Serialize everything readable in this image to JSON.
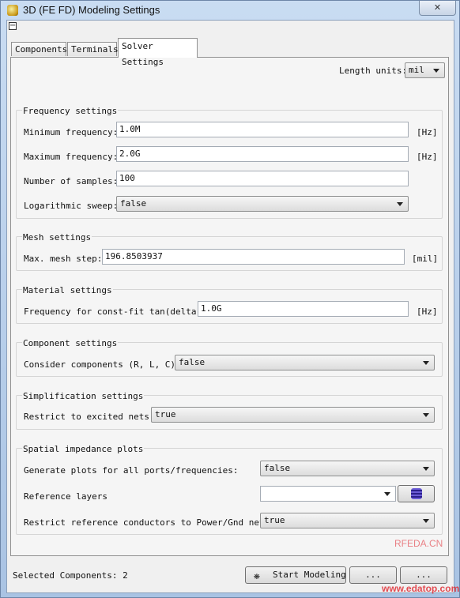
{
  "window": {
    "title": "3D (FE FD) Modeling Settings",
    "close_glyph": "✕"
  },
  "collapse_glyph": "−",
  "tabs": [
    {
      "label": "Components",
      "active": false
    },
    {
      "label": "Terminals",
      "active": false
    },
    {
      "label": "Solver Settings",
      "active": true
    }
  ],
  "length_units": {
    "label": "Length units:",
    "value": "mil"
  },
  "frequency": {
    "title": "Frequency settings",
    "min": {
      "label": "Minimum frequency:",
      "value": "1.0M",
      "unit": "[Hz]"
    },
    "max": {
      "label": "Maximum frequency:",
      "value": "2.0G",
      "unit": "[Hz]"
    },
    "samples": {
      "label": "Number of samples:",
      "value": "100"
    },
    "log": {
      "label": "Logarithmic sweep:",
      "value": "false"
    }
  },
  "mesh": {
    "title": "Mesh settings",
    "label": "Max. mesh step:",
    "value": "196.8503937",
    "unit": "[mil]"
  },
  "material": {
    "title": "Material settings",
    "label": "Frequency for const-fit tan(delta):",
    "value": "1.0G",
    "unit": "[Hz]"
  },
  "component": {
    "title": "Component settings",
    "label": "Consider components (R, L, C):",
    "value": "false"
  },
  "simplification": {
    "title": "Simplification settings",
    "label": "Restrict to excited nets:",
    "value": "true"
  },
  "spatial": {
    "title": "Spatial impedance plots",
    "plots": {
      "label": "Generate plots for all ports/frequencies:",
      "value": "false"
    },
    "layers": {
      "label": "Reference layers",
      "value": ""
    },
    "restrict": {
      "label": "Restrict reference conductors to Power/Gnd nets:",
      "value": "true"
    }
  },
  "footer": {
    "selected": "Selected Components: 2",
    "start": "Start Modeling",
    "other1": "...",
    "other2": "..."
  },
  "watermarks": {
    "rfeda": "RFEDA.CN",
    "url": "www.edatop.com"
  },
  "colors": {
    "window_frame": "#bfd3ea",
    "dialog_bg": "#f0f0f0",
    "panel_bg": "#f5f5f5",
    "watermark_red": "#e0222a"
  },
  "icons": [
    "app-icon",
    "close-icon",
    "collapse-icon",
    "chevron-down-icon",
    "layer-stack-icon",
    "start-modeling-icon"
  ]
}
